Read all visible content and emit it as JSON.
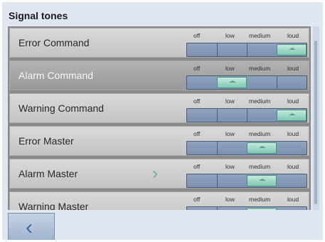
{
  "screen": {
    "title": "Signal tones",
    "levels": [
      "off",
      "low",
      "medium",
      "loud"
    ]
  },
  "rows": [
    {
      "label": "Error Command",
      "selected_level": "loud",
      "highlighted": false
    },
    {
      "label": "Alarm Command",
      "selected_level": "low",
      "highlighted": true
    },
    {
      "label": "Warning Command",
      "selected_level": "loud",
      "highlighted": false
    },
    {
      "label": "Error Master",
      "selected_level": "medium",
      "highlighted": false
    },
    {
      "label": "Alarm Master",
      "selected_level": "medium",
      "highlighted": false
    },
    {
      "label": "Warning Master",
      "selected_level": "medium",
      "highlighted": false
    }
  ],
  "icons": {
    "back": "chevron-left-icon",
    "row_expand": "chevron-right-icon"
  },
  "colors": {
    "background": "#e1e7f1",
    "track": "#7990b0",
    "thumb": "#7fc9b3",
    "accent": "#67b8a4"
  }
}
